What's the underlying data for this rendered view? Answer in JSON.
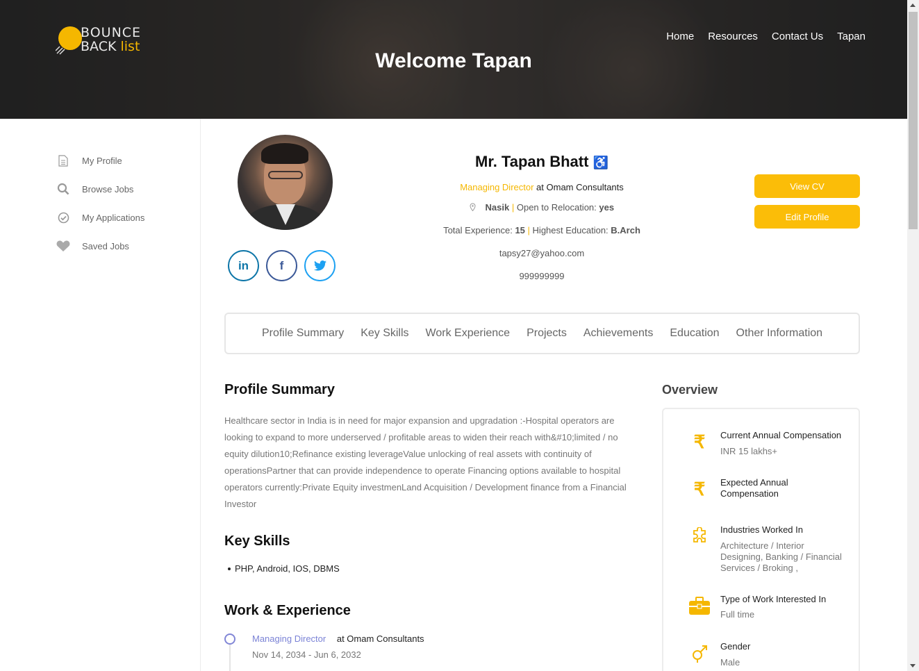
{
  "brand": {
    "line1": "BOUNCE",
    "line2_a": "BACK",
    "line2_b": "list"
  },
  "hero": {
    "title": "Welcome Tapan"
  },
  "nav": [
    "Home",
    "Resources",
    "Contact Us",
    "Tapan"
  ],
  "sidebar": [
    {
      "label": "My Profile",
      "icon": "document-icon"
    },
    {
      "label": "Browse Jobs",
      "icon": "search-icon"
    },
    {
      "label": "My Applications",
      "icon": "check-circle-icon"
    },
    {
      "label": "Saved Jobs",
      "icon": "heart-icon"
    }
  ],
  "profile": {
    "name": "Mr. Tapan Bhatt",
    "accessibility": "♿",
    "role": "Managing Director",
    "at": "at",
    "company": "Omam Consultants",
    "location": "Nasik",
    "relocation_label": "Open to Relocation:",
    "relocation_value": "yes",
    "experience_label": "Total Experience:",
    "experience_value": "15",
    "education_label": "Highest Education:",
    "education_value": "B.Arch",
    "email": "tapsy27@yahoo.com",
    "phone": "999999999",
    "social": {
      "linkedin": "in",
      "facebook": "f",
      "twitter": "t"
    }
  },
  "buttons": {
    "view_cv": "View CV",
    "edit_profile": "Edit Profile"
  },
  "tabs": [
    "Profile Summary",
    "Key Skills",
    "Work Experience",
    "Projects",
    "Achievements",
    "Education",
    "Other Information"
  ],
  "sections": {
    "summary_title": "Profile Summary",
    "summary_text": "Healthcare sector in India is in need for major expansion and upgradation :-Hospital operators are looking to expand to more underserved / profitable areas to widen their reach with&#10;limited / no equity dilution10;Refinance existing leverageValue unlocking of real assets with continuity of operationsPartner that can provide independence to operate Financing options available to hospital operators currently:Private Equity investmenLand Acquisition / Development finance from a Financial Investor",
    "skills_title": "Key Skills",
    "skills": "PHP, Android, IOS, DBMS",
    "experience_title": "Work & Experience",
    "experience": {
      "role": "Managing Director",
      "company": "at Omam Consultants",
      "dates": "Nov 14, 2034 - Jun 6, 2032"
    }
  },
  "overview": {
    "title": "Overview",
    "items": [
      {
        "label": "Current Annual Compensation",
        "value": "INR 15 lakhs+",
        "icon": "rupee-icon"
      },
      {
        "label": "Expected Annual Compensation",
        "value": "",
        "icon": "rupee-icon"
      },
      {
        "label": "Industries Worked In",
        "value": "Architecture / Interior Designing, Banking / Financial Services / Broking ,",
        "icon": "puzzle-icon"
      },
      {
        "label": "Type of Work Interested In",
        "value": "Full time",
        "icon": "briefcase-icon"
      },
      {
        "label": "Gender",
        "value": "Male",
        "icon": "gender-icon"
      }
    ]
  },
  "colors": {
    "accent": "#fbbd08",
    "timeline": "#8186d6"
  }
}
